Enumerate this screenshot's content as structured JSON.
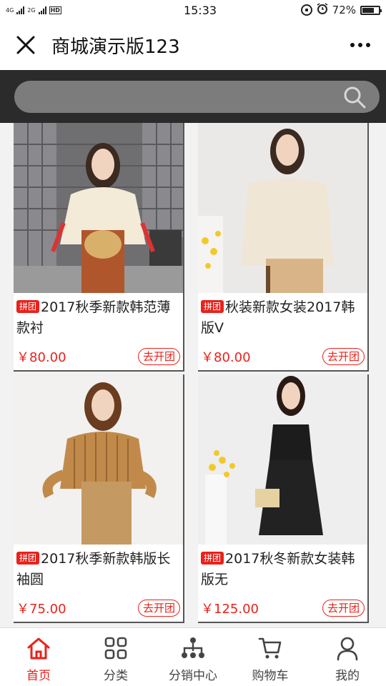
{
  "status_bar": {
    "network_1": "4G",
    "network_2": "2G",
    "hd": "HD",
    "time": "15:33",
    "battery": "72%",
    "battery_level": 0.72
  },
  "header": {
    "title": "商城演示版123",
    "close_icon": "close-icon",
    "more_icon": "more-icon"
  },
  "search": {
    "placeholder": "",
    "icon": "search-icon"
  },
  "colors": {
    "accent": "#e8221b",
    "search_bg": "#2b2b2b"
  },
  "products": [
    {
      "tag": "拼团",
      "name": "2017秋季新款韩范薄款衬",
      "price": "￥80.00",
      "action": "去开团"
    },
    {
      "tag": "拼团",
      "name": "秋装新款女装2017韩版V",
      "price": "￥80.00",
      "action": "去开团"
    },
    {
      "tag": "拼团",
      "name": "2017秋季新款韩版长袖圆",
      "price": "￥75.00",
      "action": "去开团"
    },
    {
      "tag": "拼团",
      "name": "2017秋冬新款女装韩版无",
      "price": "￥125.00",
      "action": "去开团"
    }
  ],
  "tabs": [
    {
      "label": "首页",
      "icon": "home-icon",
      "active": true
    },
    {
      "label": "分类",
      "icon": "category-icon",
      "active": false
    },
    {
      "label": "分销中心",
      "icon": "distribution-icon",
      "active": false
    },
    {
      "label": "购物车",
      "icon": "cart-icon",
      "active": false
    },
    {
      "label": "我的",
      "icon": "user-icon",
      "active": false
    }
  ]
}
